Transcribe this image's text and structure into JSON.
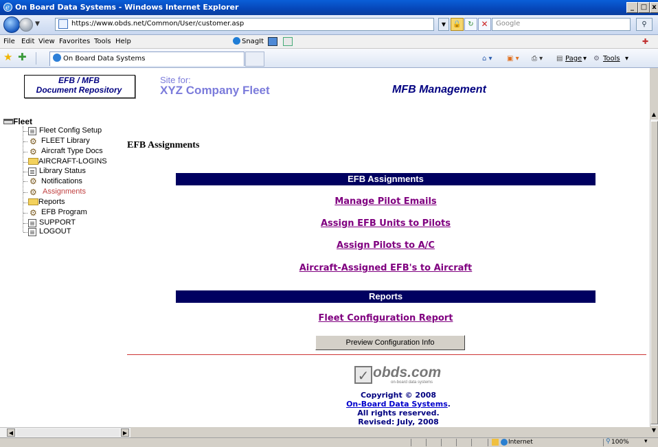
{
  "window": {
    "title": "On Board Data Systems - Windows Internet Explorer",
    "minimize": "_",
    "maximize": "□",
    "close": "x"
  },
  "address": {
    "url": "https://www.obds.net/Common/User/customer.asp",
    "search_placeholder": "Google"
  },
  "menu": [
    "File",
    "Edit",
    "View",
    "Favorites",
    "Tools",
    "Help"
  ],
  "toolbar_extras": {
    "snagit": "SnagIt"
  },
  "tab": {
    "label": "On Board Data Systems"
  },
  "commands": {
    "page": "Page",
    "tools": "Tools"
  },
  "header": {
    "logo_line1": "EFB / MFB",
    "logo_line2": "Document Repository",
    "site_for": "Site for:",
    "company": "XYZ Company  Fleet",
    "section": "MFB Management"
  },
  "tree": {
    "root": "Fleet",
    "items": [
      {
        "label": "Fleet Config Setup",
        "icon": "document-icon"
      },
      {
        "label": "FLEET Library",
        "icon": "gears-icon"
      },
      {
        "label": "Aircraft Type Docs",
        "icon": "gears-icon"
      },
      {
        "label": "AIRCRAFT-LOGINS",
        "icon": "folder-icon"
      },
      {
        "label": "Library Status",
        "icon": "document-icon"
      },
      {
        "label": "Notifications",
        "icon": "gears-icon"
      },
      {
        "label": "Assignments",
        "icon": "gears-icon",
        "selected": true
      },
      {
        "label": "Reports",
        "icon": "folder-icon"
      },
      {
        "label": "EFB Program",
        "icon": "gears-icon"
      },
      {
        "label": "SUPPORT",
        "icon": "document-icon"
      },
      {
        "label": "LOGOUT",
        "icon": "document-icon"
      }
    ]
  },
  "main": {
    "heading": "EFB Assignments",
    "section1_title": "EFB Assignments",
    "links": [
      "Manage Pilot Emails",
      "Assign EFB Units to Pilots",
      "Assign Pilots to A/C",
      "Aircraft-Assigned EFB's to Aircraft"
    ],
    "section2_title": "Reports",
    "report_link": "Fleet Configuration Report",
    "preview_button": "Preview Configuration Info"
  },
  "footer": {
    "logo_text": "obds.com",
    "logo_sub": "on-board data systems",
    "copyright": "Copyright © 2008",
    "company_link": "On-Board Data Systems",
    "period": ".",
    "rights": "All rights reserved.",
    "revised": "Revised: July, 2008"
  },
  "status": {
    "zone": "Internet",
    "zoom": "100%"
  },
  "colors": {
    "nav_bar": "#000060",
    "link_visited": "#800080",
    "site_text": "#7b7bdb",
    "brand_navy": "#000080"
  }
}
